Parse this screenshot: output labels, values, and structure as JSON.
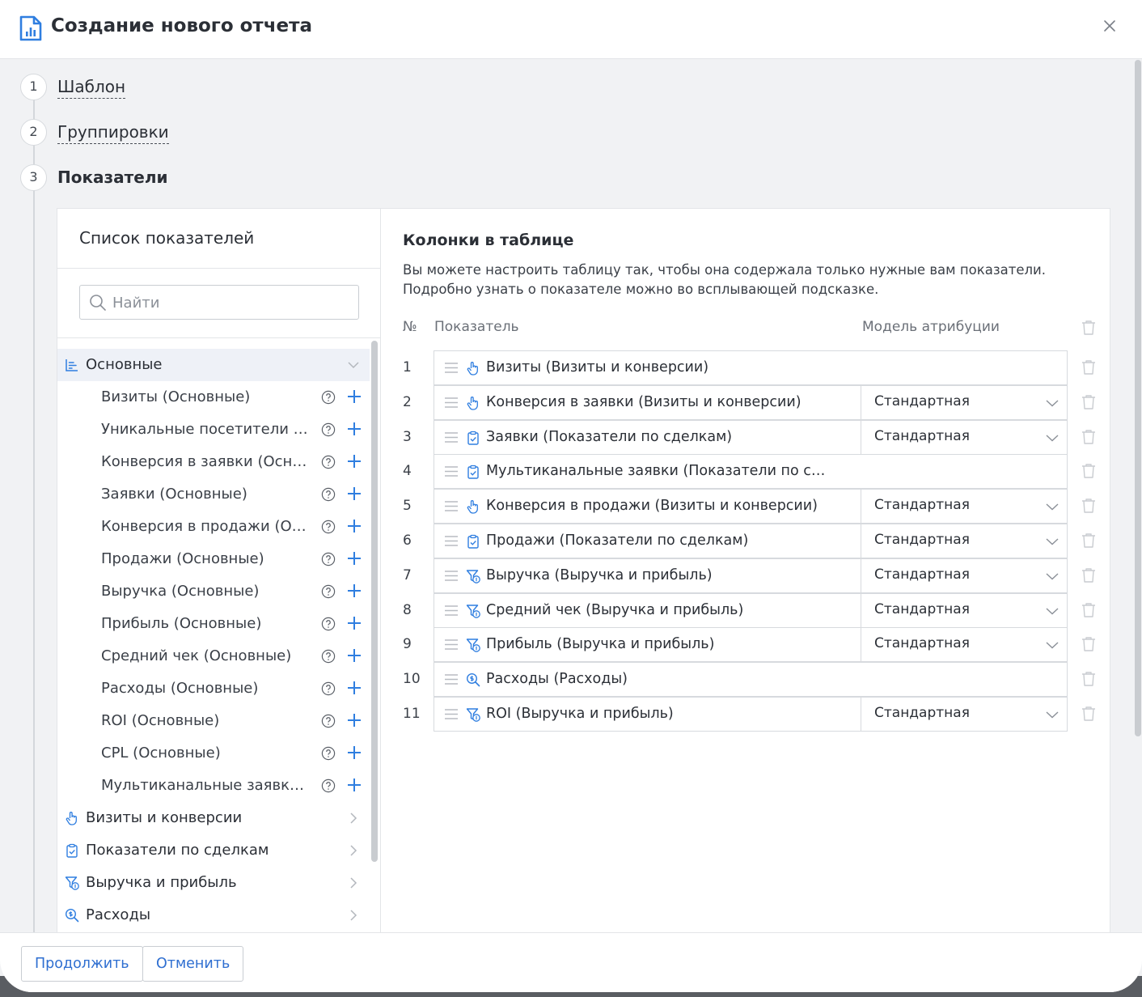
{
  "header": {
    "title": "Создание нового отчета"
  },
  "steps": [
    {
      "num": "1",
      "label": "Шаблон"
    },
    {
      "num": "2",
      "label": "Группировки"
    },
    {
      "num": "3",
      "label": "Показатели"
    }
  ],
  "left": {
    "title": "Список показателей",
    "search_placeholder": "Найти",
    "categories": [
      {
        "label": "Основные",
        "icon": "list-chart-icon",
        "expanded": true
      },
      {
        "label": "Визиты и конверсии",
        "icon": "hand-pointer-icon"
      },
      {
        "label": "Показатели по сделкам",
        "icon": "clipboard-check-icon"
      },
      {
        "label": "Выручка и прибыль",
        "icon": "funnel-dollar-icon"
      },
      {
        "label": "Расходы",
        "icon": "search-dollar-icon"
      }
    ],
    "items": [
      "Визиты (Основные)",
      "Уникальные посетители (Осн…",
      "Конверсия в заявки (Основные)",
      "Заявки (Основные)",
      "Конверсия в продажи (Основ…",
      "Продажи (Основные)",
      "Выручка (Основные)",
      "Прибыль (Основные)",
      "Средний чек (Основные)",
      "Расходы (Основные)",
      "ROI (Основные)",
      "CPL (Основные)",
      "Мультиканальные заявки (Ос…"
    ]
  },
  "right": {
    "title": "Колонки в таблице",
    "desc_line1": "Вы можете настроить таблицу так, чтобы она содержала только нужные вам показатели.",
    "desc_line2": "Подробно узнать о показателе можно во всплывающей подсказке.",
    "col_num": "№",
    "col_metric": "Показатель",
    "col_model": "Модель атрибуции",
    "rows": [
      {
        "num": "1",
        "icon": "hand-pointer-icon",
        "label": "Визиты (Визиты и конверсии)",
        "model": ""
      },
      {
        "num": "2",
        "icon": "hand-pointer-icon",
        "label": "Конверсия в заявки (Визиты и конверсии)",
        "model": "Стандартная"
      },
      {
        "num": "3",
        "icon": "clipboard-check-icon",
        "label": "Заявки (Показатели по сделкам)",
        "model": "Стандартная"
      },
      {
        "num": "4",
        "icon": "clipboard-check-icon",
        "label": "Мультиканальные заявки (Показатели по сделка…",
        "model": ""
      },
      {
        "num": "5",
        "icon": "hand-pointer-icon",
        "label": "Конверсия в продажи (Визиты и конверсии)",
        "model": "Стандартная"
      },
      {
        "num": "6",
        "icon": "clipboard-check-icon",
        "label": "Продажи (Показатели по сделкам)",
        "model": "Стандартная"
      },
      {
        "num": "7",
        "icon": "funnel-dollar-icon",
        "label": "Выручка (Выручка и прибыль)",
        "model": "Стандартная"
      },
      {
        "num": "8",
        "icon": "funnel-dollar-icon",
        "label": "Средний чек (Выручка и прибыль)",
        "model": "Стандартная"
      },
      {
        "num": "9",
        "icon": "funnel-dollar-icon",
        "label": "Прибыль (Выручка и прибыль)",
        "model": "Стандартная"
      },
      {
        "num": "10",
        "icon": "search-dollar-icon",
        "label": "Расходы (Расходы)",
        "model": ""
      },
      {
        "num": "11",
        "icon": "funnel-dollar-icon",
        "label": "ROI (Выручка и прибыль)",
        "model": "Стандартная"
      }
    ]
  },
  "footer": {
    "continue_label": "Продолжить",
    "cancel_label": "Отменить"
  },
  "colors": {
    "accent": "#2f7ee0",
    "text": "#2b2f36",
    "muted": "#8b9098",
    "border": "#d7dade",
    "bg": "#f1f2f4"
  }
}
